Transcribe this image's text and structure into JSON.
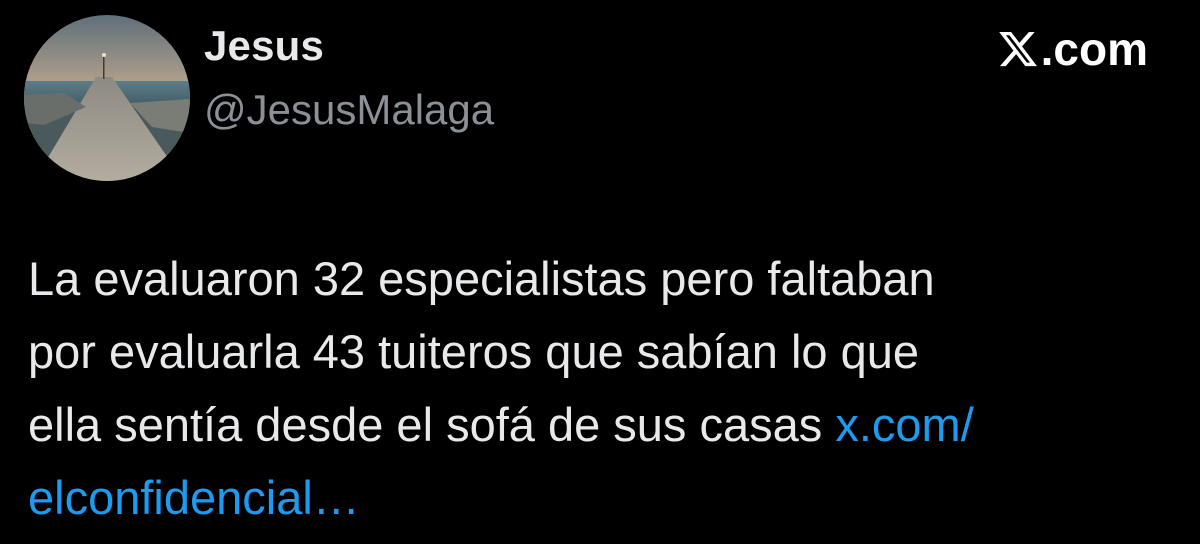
{
  "author": {
    "display_name": "Jesus",
    "handle": "@JesusMalaga",
    "avatar": "pier-at-sunset-photo"
  },
  "brand": {
    "icon": "x-logo-icon",
    "text": ".com"
  },
  "tweet": {
    "lines": [
      "La evaluaron 32 especialistas pero faltaban",
      "por evaluarla 43 tuiteros que sabían lo que",
      "ella sentía desde el sofá de sus casas "
    ],
    "link_line1": "x.com/",
    "link_line2": "elconfidencial…"
  },
  "colors": {
    "background": "#000000",
    "text": "#e7e9ea",
    "handle": "#8b9096",
    "link": "#1d9bf0"
  }
}
